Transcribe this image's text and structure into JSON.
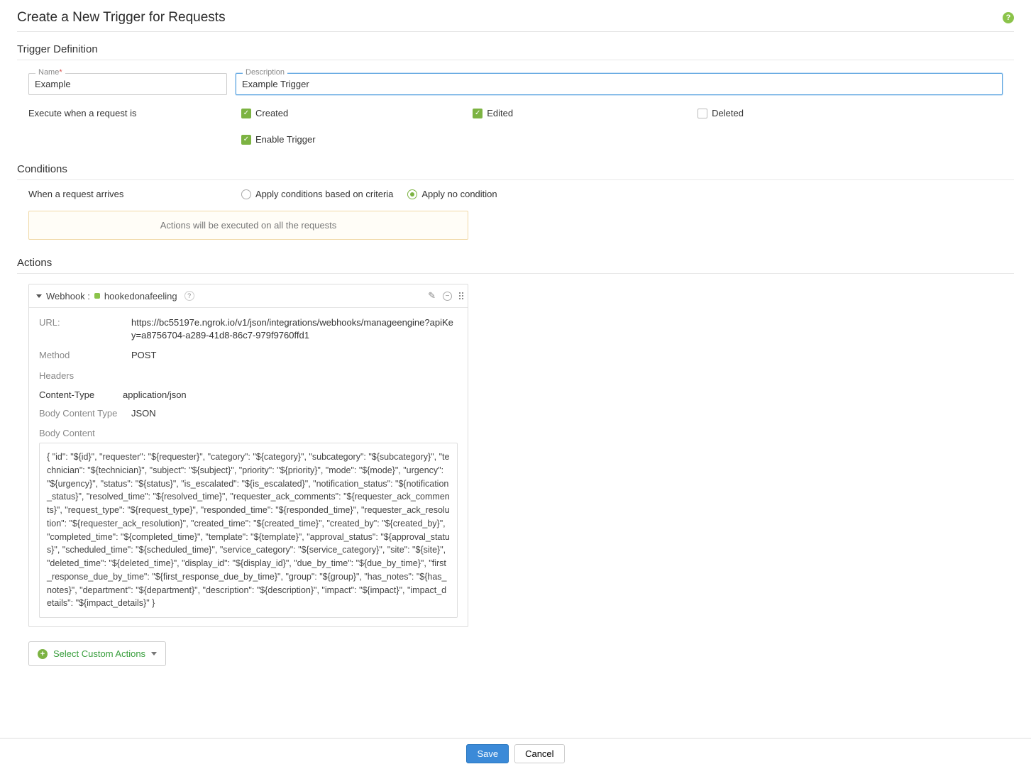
{
  "header": {
    "title": "Create a New Trigger for Requests"
  },
  "sections": {
    "definition_title": "Trigger Definition",
    "conditions_title": "Conditions",
    "actions_title": "Actions"
  },
  "definition": {
    "name_label": "Name",
    "name_value": "Example",
    "desc_label": "Description",
    "desc_value": "Example Trigger",
    "execute_label": "Execute when a request is",
    "opt_created": "Created",
    "opt_edited": "Edited",
    "opt_deleted": "Deleted",
    "opt_enable": "Enable Trigger"
  },
  "conditions": {
    "arrives_label": "When a request arrives",
    "radio_criteria": "Apply conditions based on criteria",
    "radio_none": "Apply no condition",
    "banner": "Actions will be executed on all the requests"
  },
  "action": {
    "webhook_label": "Webhook :",
    "webhook_name": "hookedonafeeling",
    "url_label": "URL:",
    "url_value": "https://bc55197e.ngrok.io/v1/json/integrations/webhooks/manageengine?apiKey=a8756704-a289-41d8-86c7-979f9760ffd1",
    "method_label": "Method",
    "method_value": "POST",
    "headers_label": "Headers",
    "hk": "Content-Type",
    "hv": "application/json",
    "bct_label": "Body Content Type",
    "bct_value": "JSON",
    "bc_label": "Body Content",
    "bc_value": "{ \"id\": \"${id}\", \"requester\": \"${requester}\", \"category\": \"${category}\", \"subcategory\": \"${subcategory}\", \"technician\": \"${technician}\", \"subject\": \"${subject}\", \"priority\": \"${priority}\", \"mode\": \"${mode}\", \"urgency\": \"${urgency}\", \"status\": \"${status}\", \"is_escalated\": \"${is_escalated}\", \"notification_status\": \"${notification_status}\", \"resolved_time\": \"${resolved_time}\", \"requester_ack_comments\": \"${requester_ack_comments}\", \"request_type\": \"${request_type}\", \"responded_time\": \"${responded_time}\", \"requester_ack_resolution\": \"${requester_ack_resolution}\", \"created_time\": \"${created_time}\", \"created_by\": \"${created_by}\", \"completed_time\": \"${completed_time}\", \"template\": \"${template}\", \"approval_status\": \"${approval_status}\", \"scheduled_time\": \"${scheduled_time}\", \"service_category\": \"${service_category}\", \"site\": \"${site}\", \"deleted_time\": \"${deleted_time}\", \"display_id\": \"${display_id}\", \"due_by_time\": \"${due_by_time}\", \"first_response_due_by_time\": \"${first_response_due_by_time}\", \"group\": \"${group}\", \"has_notes\": \"${has_notes}\", \"department\": \"${department}\", \"description\": \"${description}\", \"impact\": \"${impact}\", \"impact_details\": \"${impact_details}\" }"
  },
  "select_actions_btn": "Select Custom Actions",
  "footer": {
    "save": "Save",
    "cancel": "Cancel"
  }
}
